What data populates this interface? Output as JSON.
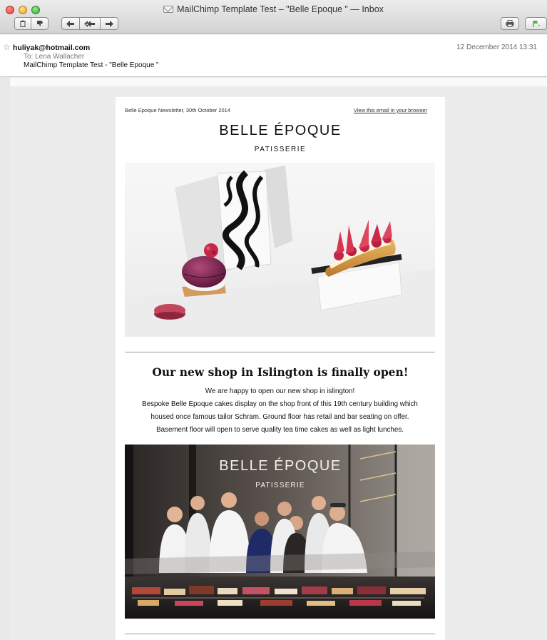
{
  "window": {
    "title": "MailChimp Template Test – \"Belle Epoque \" — Inbox"
  },
  "toolbar": {
    "delete_icon": "trash-icon",
    "junk_icon": "thumbs-down-icon",
    "reply_icon": "reply-icon",
    "reply_all_icon": "reply-all-icon",
    "forward_icon": "forward-icon",
    "print_icon": "printer-icon",
    "flag_icon": "flag-icon"
  },
  "message": {
    "from": "huliyak@hotmail.com",
    "to": "To:  Lena Wallacher",
    "subject": "MailChimp Template Test - \"Belle Epoque \"",
    "date": "12 December 2014 13:31"
  },
  "email": {
    "preheader": "Belle Epoque Newsletter, 30th October 2014",
    "view_in_browser": "View this email in your browser",
    "brand": "BELLE ÉPOQUE",
    "brand_sub": "PATISSERIE",
    "headline": "Our new shop in Islington is finally open!",
    "lines": [
      "We are happy to open our new shop in islington!",
      "Bespoke Belle Epoque cakes display on the shop front of this 19th century building which",
      "housed once famous tailor Schram. Ground floor has retail and bar seating on offer.",
      "Basement floor will open to serve quality tea time cakes as well as light lunches."
    ],
    "shop_sign": "BELLE ÉPOQUE",
    "shop_sign_sub": "PATISSERIE"
  },
  "colors": {
    "accent_pink": "#c4264a",
    "macaron": "#b83a55",
    "dark_shop": "#1d1b1b"
  }
}
